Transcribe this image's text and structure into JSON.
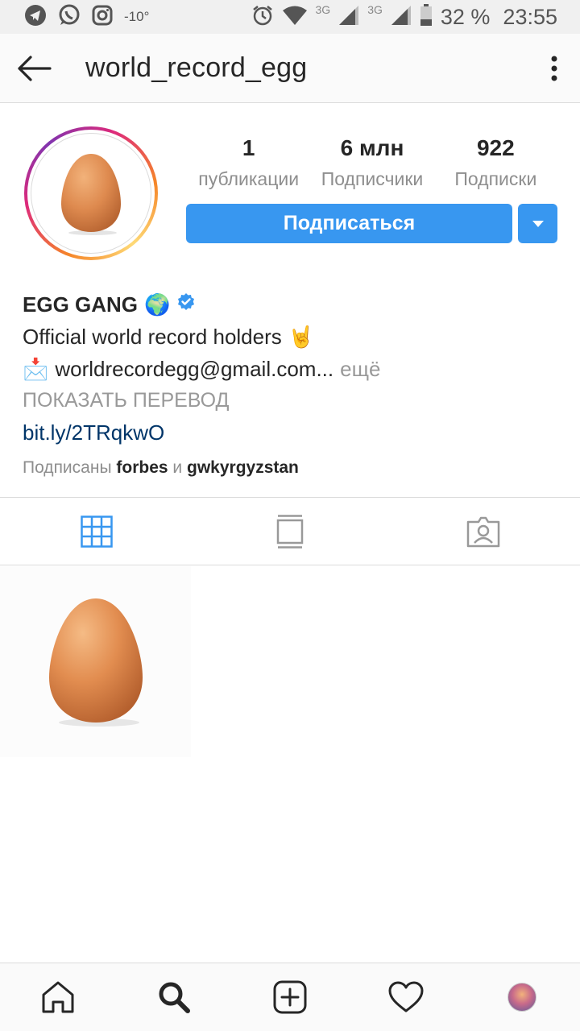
{
  "status_bar": {
    "temperature": "-10°",
    "network_1": "3G",
    "network_2": "3G",
    "battery": "32 %",
    "time": "23:55"
  },
  "app_bar": {
    "username": "world_record_egg"
  },
  "profile": {
    "stats": [
      {
        "value": "1",
        "label": "публикации"
      },
      {
        "value": "6 млн",
        "label": "Подписчики"
      },
      {
        "value": "922",
        "label": "Подписки"
      }
    ],
    "follow_label": "Подписаться"
  },
  "bio": {
    "name": "EGG GANG",
    "name_emoji": "🌍",
    "line1": "Official world record holders",
    "line1_emoji": "🤘",
    "email_emoji": "📩",
    "email": "worldrecordegg@gmail.com...",
    "more": "ещё",
    "translate": "ПОКАЗАТЬ ПЕРЕВОД",
    "link": "bit.ly/2TRqkwO",
    "followed_prefix": "Подписаны",
    "followed_user1": "forbes",
    "followed_and": "и",
    "followed_user2": "gwkyrgyzstan"
  },
  "tabs": [
    {
      "icon": "grid-icon",
      "active": true
    },
    {
      "icon": "feed-icon",
      "active": false
    },
    {
      "icon": "tagged-icon",
      "active": false
    }
  ],
  "bottom_nav": [
    {
      "icon": "home-icon"
    },
    {
      "icon": "search-icon"
    },
    {
      "icon": "add-icon"
    },
    {
      "icon": "heart-icon"
    },
    {
      "icon": "profile-avatar"
    }
  ],
  "colors": {
    "accent": "#3897f0",
    "link": "#003569",
    "muted": "#8e8e8e"
  }
}
